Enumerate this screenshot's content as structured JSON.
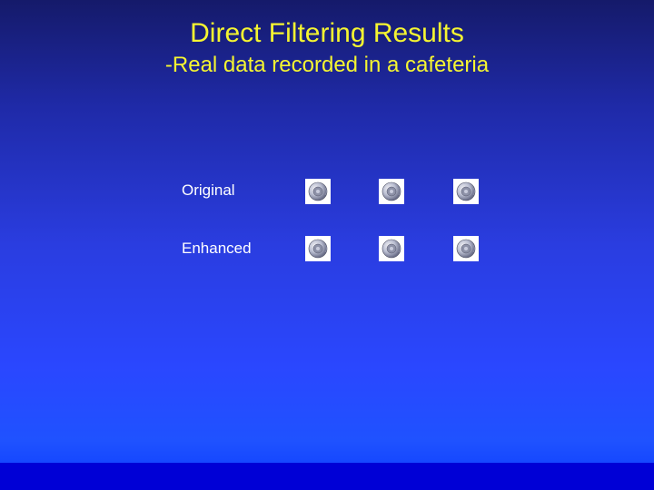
{
  "slide": {
    "title": "Direct Filtering Results",
    "subtitle": "-Real data recorded in a cafeteria",
    "rows": {
      "original_label": "Original",
      "enhanced_label": "Enhanced"
    }
  }
}
